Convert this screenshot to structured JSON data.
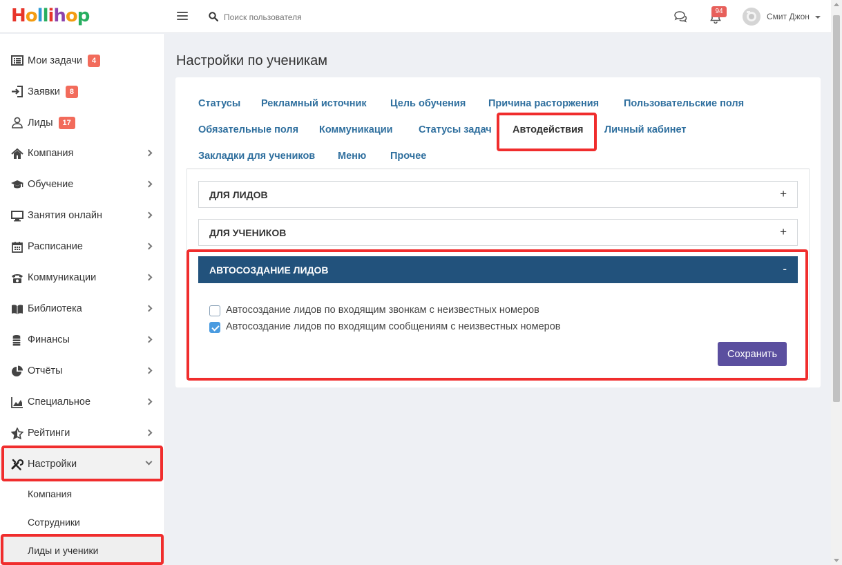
{
  "brand": {
    "logo_letters": [
      "H",
      "o",
      "l",
      "l",
      "i",
      "h",
      "o",
      "p"
    ],
    "logo_colors": [
      "#e8352a",
      "#f39c12",
      "#2e9bd6",
      "#27ae60",
      "#e8352a",
      "#8e44ad",
      "#f39c12",
      "#27ae60"
    ]
  },
  "topbar": {
    "menu_icon": "hamburger-icon",
    "search_placeholder": "Поиск пользователя",
    "chat_icon": "chat-icon",
    "bell_icon": "bell-icon",
    "notifications_count": "94",
    "user_name": "Смит Джон"
  },
  "sidebar": {
    "items": [
      {
        "label": "Мои задачи",
        "icon": "tasks-icon",
        "badge": "4"
      },
      {
        "label": "Заявки",
        "icon": "sign-in-icon",
        "badge": "8"
      },
      {
        "label": "Лиды",
        "icon": "user-icon",
        "badge": "17"
      },
      {
        "label": "Компания",
        "icon": "home-icon"
      },
      {
        "label": "Обучение",
        "icon": "graduation-cap-icon"
      },
      {
        "label": "Занятия онлайн",
        "icon": "monitor-icon"
      },
      {
        "label": "Расписание",
        "icon": "calendar-icon"
      },
      {
        "label": "Коммуникации",
        "icon": "phone-icon"
      },
      {
        "label": "Библиотека",
        "icon": "book-icon"
      },
      {
        "label": "Финансы",
        "icon": "coins-icon"
      },
      {
        "label": "Отчёты",
        "icon": "pie-chart-icon"
      },
      {
        "label": "Специальное",
        "icon": "area-chart-icon"
      },
      {
        "label": "Рейтинги",
        "icon": "star-icon"
      },
      {
        "label": "Настройки",
        "icon": "tools-icon"
      }
    ],
    "subitems": [
      {
        "label": "Компания"
      },
      {
        "label": "Сотрудники"
      },
      {
        "label": "Лиды и ученики"
      }
    ]
  },
  "main": {
    "title": "Настройки по ученикам",
    "tabs": [
      {
        "label": "Статусы"
      },
      {
        "label": "Рекламный источник"
      },
      {
        "label": "Цель обучения"
      },
      {
        "label": "Причина расторжения"
      },
      {
        "label": "Пользовательские поля"
      },
      {
        "label": "Обязательные поля"
      },
      {
        "label": "Коммуникации"
      },
      {
        "label": "Статусы задач"
      },
      {
        "label": "Автодействия"
      },
      {
        "label": "Личный кабинет"
      },
      {
        "label": "Закладки для учеников"
      },
      {
        "label": "Меню"
      },
      {
        "label": "Прочее"
      }
    ],
    "active_tab": "Автодействия",
    "accordions": [
      {
        "title": "ДЛЯ ЛИДОВ",
        "toggle": "+"
      },
      {
        "title": "ДЛЯ УЧЕНИКОВ",
        "toggle": "+"
      },
      {
        "title": "АВТОСОЗДАНИЕ ЛИДОВ",
        "toggle": "-"
      }
    ],
    "options": [
      {
        "label": "Автосоздание лидов по входящим звонкам с неизвестных номеров",
        "checked": false
      },
      {
        "label": "Автосоздание лидов по входящим сообщениям с неизвестных номеров",
        "checked": true
      }
    ],
    "save_label": "Сохранить"
  },
  "colors": {
    "accent_dark_blue": "#22527c",
    "link_blue": "#2f6f9e",
    "button_purple": "#5b4f9f",
    "badge_red": "#f26b5b",
    "highlight_red": "#f02d2d",
    "checkbox_blue": "#4a9be0"
  }
}
